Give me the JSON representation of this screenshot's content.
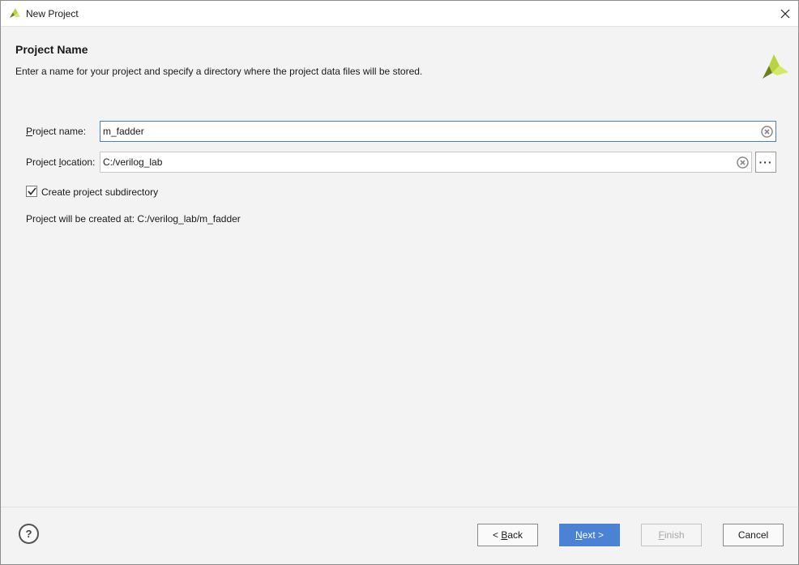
{
  "window": {
    "title": "New Project",
    "close_icon": "close-icon",
    "logo_icon": "vivado-logo"
  },
  "header": {
    "title": "Project Name",
    "subtitle": "Enter a name for your project and specify a directory where the project data files will be stored."
  },
  "form": {
    "project_name_label_prefix": "P",
    "project_name_label_rest": "roject name:",
    "project_name_value": "m_fadder",
    "project_location_label_prefix": "Project ",
    "project_location_label_mnemonic": "l",
    "project_location_label_rest": "ocation:",
    "project_location_value": "C:/verilog_lab",
    "browse_label": "···",
    "subdirectory_checkbox_label": "Create project subdirectory",
    "subdirectory_checked": true,
    "created_at_text": "Project will be created at: C:/verilog_lab/m_fadder"
  },
  "footer": {
    "help_label": "?",
    "back_label_prefix": "< ",
    "back_label_mnemonic": "B",
    "back_label_rest": "ack",
    "next_label_mnemonic": "N",
    "next_label_rest": "ext >",
    "finish_label_mnemonic": "F",
    "finish_label_rest": "inish",
    "cancel_label": "Cancel"
  },
  "colors": {
    "accent": "#4b82d4",
    "logo_green": "#a5c63b"
  }
}
